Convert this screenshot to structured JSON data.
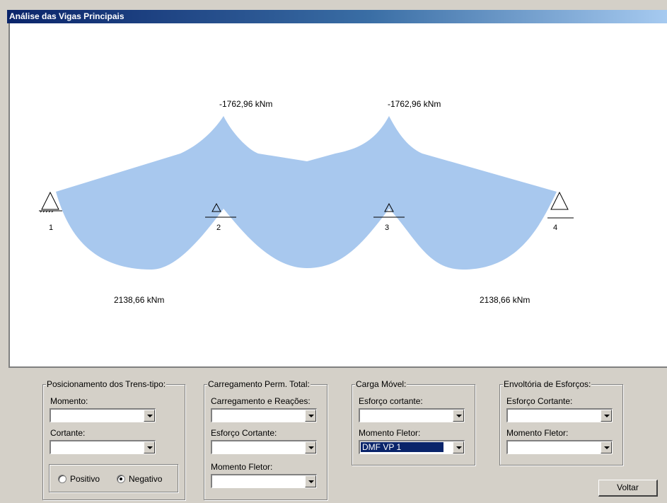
{
  "window": {
    "title": "Análise das Vigas Principais"
  },
  "diagram": {
    "supports": [
      "1",
      "2",
      "3",
      "4"
    ],
    "labels": {
      "neg_moment_left": "-1762,96 kNm",
      "neg_moment_right": "-1762,96 kNm",
      "pos_moment_left": "2138,66 kNm",
      "pos_moment_right": "2138,66 kNm"
    },
    "fill_color": "#a8c8ee"
  },
  "trens_tipo": {
    "legend": "Posicionamento dos Trens-tipo:",
    "momento_label": "Momento:",
    "momento_value": "",
    "cortante_label": "Cortante:",
    "cortante_value": "",
    "positivo_label": "Positivo",
    "negativo_label": "Negativo",
    "selected": "Negativo"
  },
  "carregamento": {
    "legend": "Carregamento Perm. Total:",
    "reacoes_label": "Carregamento e Reações:",
    "reacoes_value": "",
    "cortante_label": "Esforço Cortante:",
    "cortante_value": "",
    "fletor_label": "Momento Fletor:",
    "fletor_value": ""
  },
  "carga_movel": {
    "legend": "Carga Móvel:",
    "cortante_label": "Esforço cortante:",
    "cortante_value": "",
    "fletor_label": "Momento Fletor:",
    "fletor_value": "DMF VP 1"
  },
  "envoltoria": {
    "legend": "Envoltória de Esforços:",
    "cortante_label": "Esforço Cortante:",
    "cortante_value": "",
    "fletor_label": "Momento Fletor:",
    "fletor_value": ""
  },
  "actions": {
    "voltar_label": "Voltar"
  },
  "colors": {
    "title_start": "#0a246a",
    "title_end": "#a6caf0",
    "selection": "#0a246a"
  }
}
